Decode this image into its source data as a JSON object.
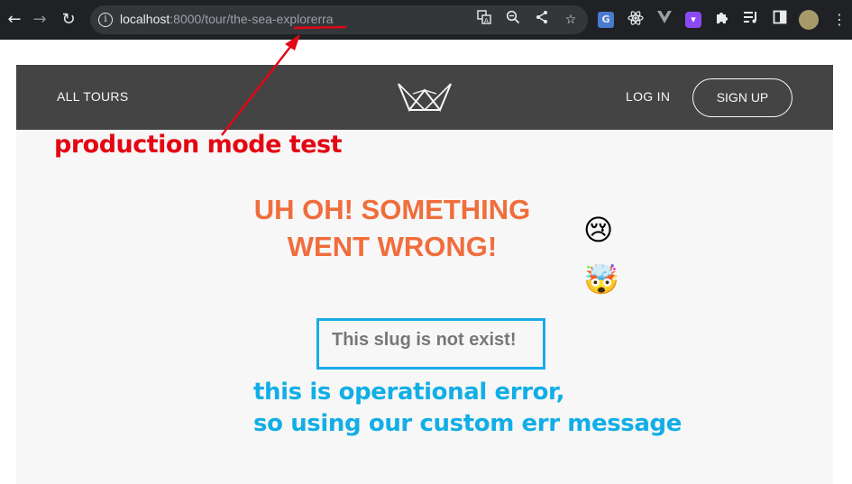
{
  "browser": {
    "url_host": "localhost",
    "url_path": ":8000/tour/the-sea-explorerra",
    "nav_back": "←",
    "nav_forward": "→",
    "nav_reload": "↻",
    "icons": [
      "translate-icon",
      "zoom-icon",
      "share-icon",
      "bookmark-star-icon"
    ],
    "extensions": [
      "google-translate-extension-icon",
      "react-devtools-icon",
      "vue-devtools-icon",
      "purple-extension-icon",
      "puzzle-extensions-icon",
      "media-queue-icon",
      "sidebar-icon",
      "profile-avatar",
      "menu-dots-icon"
    ]
  },
  "site": {
    "nav_all_tours": "ALL TOURS",
    "nav_login": "LOG IN",
    "nav_signup": "SIGN UP"
  },
  "error": {
    "title_line1": "UH OH! SOMETHING",
    "title_line2": "WENT WRONG!",
    "emoji_crying": "😢",
    "emoji_exploding": "🤯",
    "message": "This slug is not exist!"
  },
  "annotations": {
    "red_label": "production mode test",
    "blue_line1": "this is operational error,",
    "blue_line2": "so using our custom err message",
    "red_color": "#e30613",
    "blue_color": "#12aee6"
  },
  "colors": {
    "header_bg": "#444444",
    "error_title": "#f06d3c",
    "page_bg": "#f7f7f7",
    "chrome_bg": "#202124"
  }
}
